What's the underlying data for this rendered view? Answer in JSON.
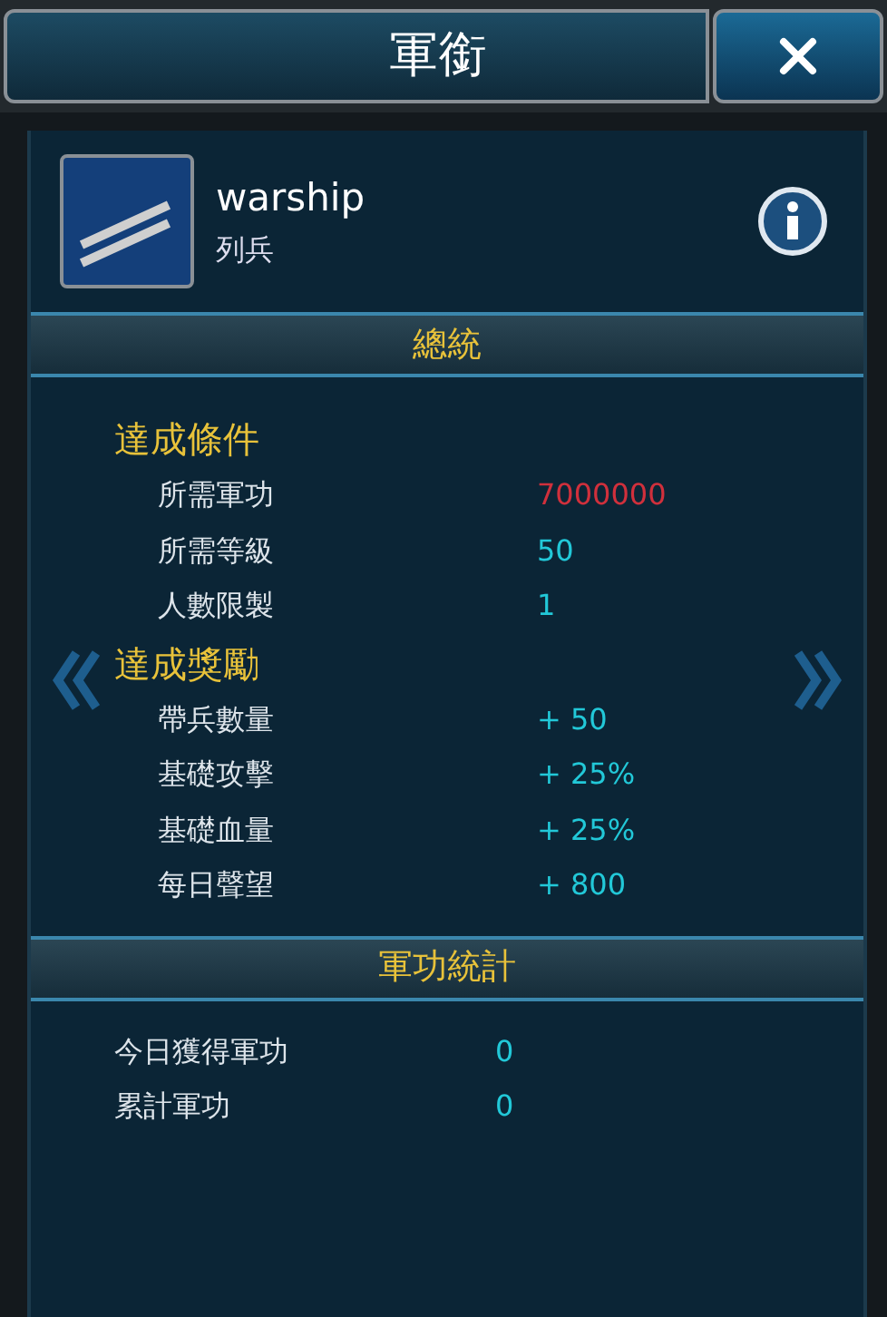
{
  "window": {
    "title": "軍銜"
  },
  "profile": {
    "name": "warship",
    "rank": "列兵"
  },
  "rank_header": "總統",
  "requirements": {
    "heading": "達成條件",
    "rows": [
      {
        "label": "所需軍功",
        "value": "7000000",
        "color": "#d0303c"
      },
      {
        "label": "所需等級",
        "value": "50",
        "color": "#22c8d8"
      },
      {
        "label": "人數限製",
        "value": "1",
        "color": "#22c8d8"
      }
    ]
  },
  "rewards": {
    "heading": "達成獎勵",
    "rows": [
      {
        "label": "帶兵數量",
        "value": "+ 50",
        "color": "#22c8d8"
      },
      {
        "label": "基礎攻擊",
        "value": "+ 25%",
        "color": "#22c8d8"
      },
      {
        "label": "基礎血量",
        "value": "+ 25%",
        "color": "#22c8d8"
      },
      {
        "label": "每日聲望",
        "value": "+ 800",
        "color": "#22c8d8"
      }
    ]
  },
  "stats": {
    "heading": "軍功統計",
    "rows": [
      {
        "label": "今日獲得軍功",
        "value": "0"
      },
      {
        "label": "累計軍功",
        "value": "0"
      }
    ]
  }
}
